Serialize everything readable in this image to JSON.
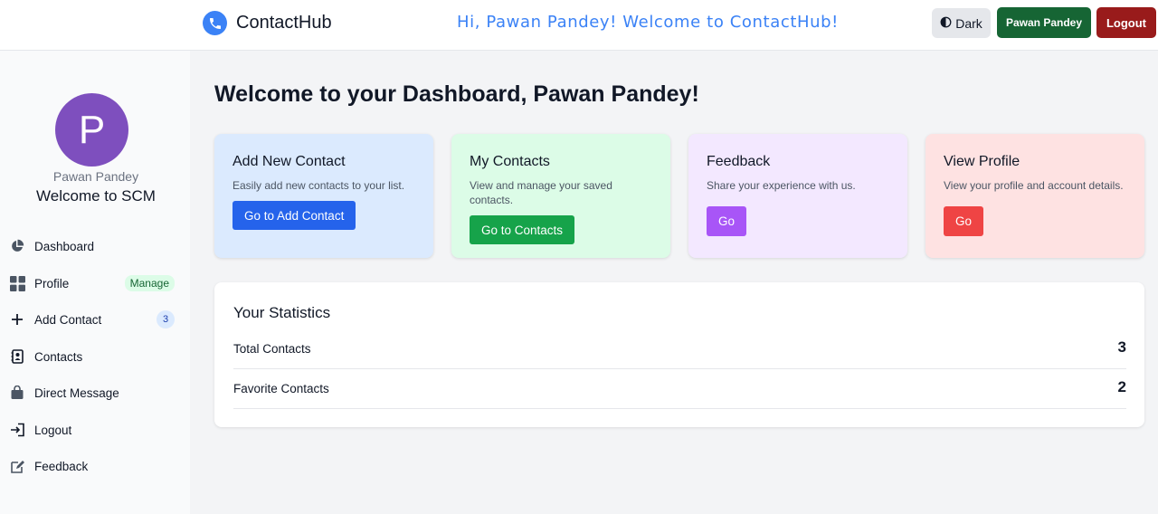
{
  "navbar": {
    "brand": "ContactHub",
    "greeting": "Hi, Pawan Pandey! Welcome to ContactHub!",
    "theme_toggle_label": "Dark",
    "user_button_label": "Pawan Pandey",
    "logout_button_label": "Logout"
  },
  "sidebar": {
    "avatar_initial": "P",
    "username": "Pawan Pandey",
    "welcome": "Welcome to SCM",
    "items": [
      {
        "label": "Dashboard",
        "icon": "pie-chart-icon"
      },
      {
        "label": "Profile",
        "icon": "grid-icon",
        "badge": "Manage"
      },
      {
        "label": "Add Contact",
        "icon": "plus-icon",
        "badge": "3"
      },
      {
        "label": "Contacts",
        "icon": "address-book-icon"
      },
      {
        "label": "Direct Message",
        "icon": "shopping-bag-icon"
      },
      {
        "label": "Logout",
        "icon": "sign-out-icon"
      },
      {
        "label": "Feedback",
        "icon": "edit-icon"
      }
    ]
  },
  "main": {
    "title": "Welcome to your Dashboard, Pawan Pandey!",
    "cards": [
      {
        "title": "Add New Contact",
        "desc": "Easily add new contacts to your list.",
        "button": "Go to Add Contact",
        "bg": "#dbeafe",
        "btn_color": "#2563eb"
      },
      {
        "title": "My Contacts",
        "desc": "View and manage your saved contacts.",
        "button": "Go to Contacts",
        "bg": "#dcfce7",
        "btn_color": "#16a34a"
      },
      {
        "title": "Feedback",
        "desc": "Share your experience with us.",
        "button": "Go",
        "bg": "#f3e8ff",
        "btn_color": "#a855f7"
      },
      {
        "title": "View Profile",
        "desc": "View your profile and account details.",
        "button": "Go",
        "bg": "#fee2e2",
        "btn_color": "#ef4444"
      }
    ],
    "stats": {
      "title": "Your Statistics",
      "rows": [
        {
          "label": "Total Contacts",
          "value": "3"
        },
        {
          "label": "Favorite Contacts",
          "value": "2"
        }
      ]
    }
  }
}
